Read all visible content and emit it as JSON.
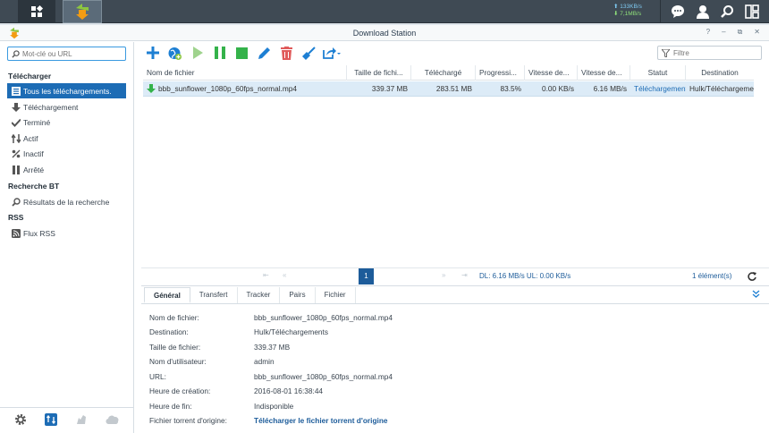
{
  "taskbar": {
    "upload_rate": "133KB/s",
    "download_rate": "7,1MB/s"
  },
  "window": {
    "title": "Download Station",
    "controls": [
      "?",
      "–",
      "⧉",
      "✕"
    ]
  },
  "sidebar": {
    "search_placeholder": "Mot-clé ou URL",
    "sections": [
      {
        "title": "Télécharger",
        "items": [
          {
            "label": "Tous les téléchargements.",
            "icon": "list-icon",
            "selected": true
          },
          {
            "label": "Téléchargement",
            "icon": "download-arrow-icon"
          },
          {
            "label": "Terminé",
            "icon": "checkmark-icon"
          },
          {
            "label": "Actif",
            "icon": "up-down-arrows-icon"
          },
          {
            "label": "Inactif",
            "icon": "percent-icon"
          },
          {
            "label": "Arrêté",
            "icon": "pause-icon"
          }
        ]
      },
      {
        "title": "Recherche BT",
        "items": [
          {
            "label": "Résultats de la recherche",
            "icon": "search-icon"
          }
        ]
      },
      {
        "title": "RSS",
        "items": [
          {
            "label": "Flux RSS",
            "icon": "rss-icon"
          }
        ]
      }
    ]
  },
  "toolbar": {
    "filter_placeholder": "Filtre",
    "tools": [
      "add-icon",
      "globe-add-icon",
      "resume-icon",
      "pause-icon",
      "stop-icon",
      "edit-icon",
      "delete-icon",
      "clean-icon",
      "share-icon"
    ]
  },
  "grid": {
    "columns": [
      "Nom de fichier",
      "Taille de fichi...",
      "Téléchargé",
      "Progressi...",
      "Vitesse de...",
      "Vitesse de...",
      "Statut",
      "Destination"
    ],
    "rows": [
      {
        "filename": "bbb_sunflower_1080p_60fps_normal.mp4",
        "size": "339.37 MB",
        "downloaded": "283.51 MB",
        "progress": "83.5%",
        "upload_speed": "0.00 KB/s",
        "download_speed": "6.16 MB/s",
        "status": "Téléchargement...",
        "destination": "Hulk/Téléchargements"
      }
    ]
  },
  "pager": {
    "page": "1",
    "rates": "DL: 6.16 MB/s  UL: 0.00 KB/s",
    "count": "1 élément(s)"
  },
  "detail": {
    "tabs": [
      "Général",
      "Transfert",
      "Tracker",
      "Pairs",
      "Fichier"
    ],
    "fields": [
      {
        "key": "Nom de fichier:",
        "value": "bbb_sunflower_1080p_60fps_normal.mp4"
      },
      {
        "key": "Destination:",
        "value": "Hulk/Téléchargements"
      },
      {
        "key": "Taille de fichier:",
        "value": "339.37 MB"
      },
      {
        "key": "Nom d'utilisateur:",
        "value": "admin"
      },
      {
        "key": "URL:",
        "value": "bbb_sunflower_1080p_60fps_normal.mp4"
      },
      {
        "key": "Heure de création:",
        "value": "2016-08-01 16:38:44"
      },
      {
        "key": "Heure de fin:",
        "value": "Indisponible"
      },
      {
        "key": "Fichier torrent d'origine:",
        "value": "Télécharger le fichier torrent d'origine"
      }
    ]
  },
  "colors": {
    "accent": "#1d6cb5",
    "taskbar": "#3f4a54",
    "row_selected": "#dcebf7"
  }
}
